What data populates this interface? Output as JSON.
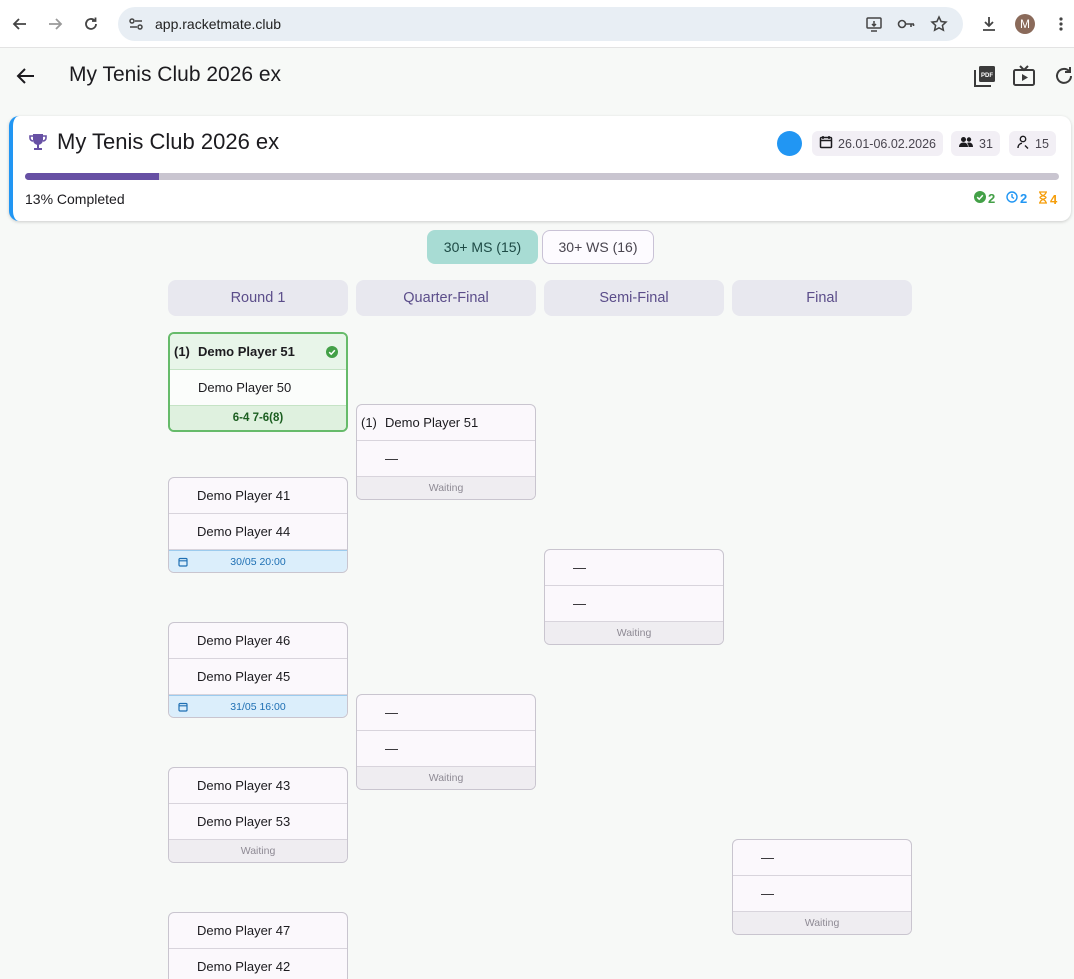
{
  "browser": {
    "url": "app.racketmate.club",
    "profile_initial": "M"
  },
  "appbar": {
    "title": "My Tenis Club 2026 ex"
  },
  "tournament": {
    "title": "My Tenis Club 2026 ex",
    "status_color": "#2196f3",
    "dates": "26.01-06.02.2026",
    "players_count": "31",
    "referees_count": "15",
    "progress_fraction": 0.13,
    "completed_label": "13% Completed",
    "stats": {
      "completed": "2",
      "scheduled": "2",
      "pending": "4"
    }
  },
  "categories": [
    {
      "label": "30+ MS (15)",
      "active": true
    },
    {
      "label": "30+ WS (16)",
      "active": false
    }
  ],
  "rounds": [
    "Round 1",
    "Quarter-Final",
    "Semi-Final",
    "Final"
  ],
  "matches": {
    "r1m1": {
      "p1_seed": "(1)",
      "p1": "Demo Player 51",
      "p2": "Demo Player 50",
      "foot": "6-4 7-6(8)"
    },
    "r1m2": {
      "p1": "Demo Player 41",
      "p2": "Demo Player 44",
      "foot": "30/05 20:00"
    },
    "r1m3": {
      "p1": "Demo Player 46",
      "p2": "Demo Player 45",
      "foot": "31/05 16:00"
    },
    "r1m4": {
      "p1": "Demo Player 43",
      "p2": "Demo Player 53",
      "foot": "Waiting"
    },
    "r1m5": {
      "p1": "Demo Player 47",
      "p2": "Demo Player 42"
    },
    "qf1": {
      "p1_seed": "(1)",
      "p1": "Demo Player 51",
      "p2": "—",
      "foot": "Waiting"
    },
    "qf2": {
      "p1": "—",
      "p2": "—",
      "foot": "Waiting"
    },
    "sf1": {
      "p1": "—",
      "p2": "—",
      "foot": "Waiting"
    },
    "f1": {
      "p1": "—",
      "p2": "—",
      "foot": "Waiting"
    }
  },
  "colors": {
    "accent": "#6750a4",
    "done_green": "#66bb6a",
    "scheduled_blue": "#2196f3",
    "pending_orange": "#f59e0b"
  }
}
